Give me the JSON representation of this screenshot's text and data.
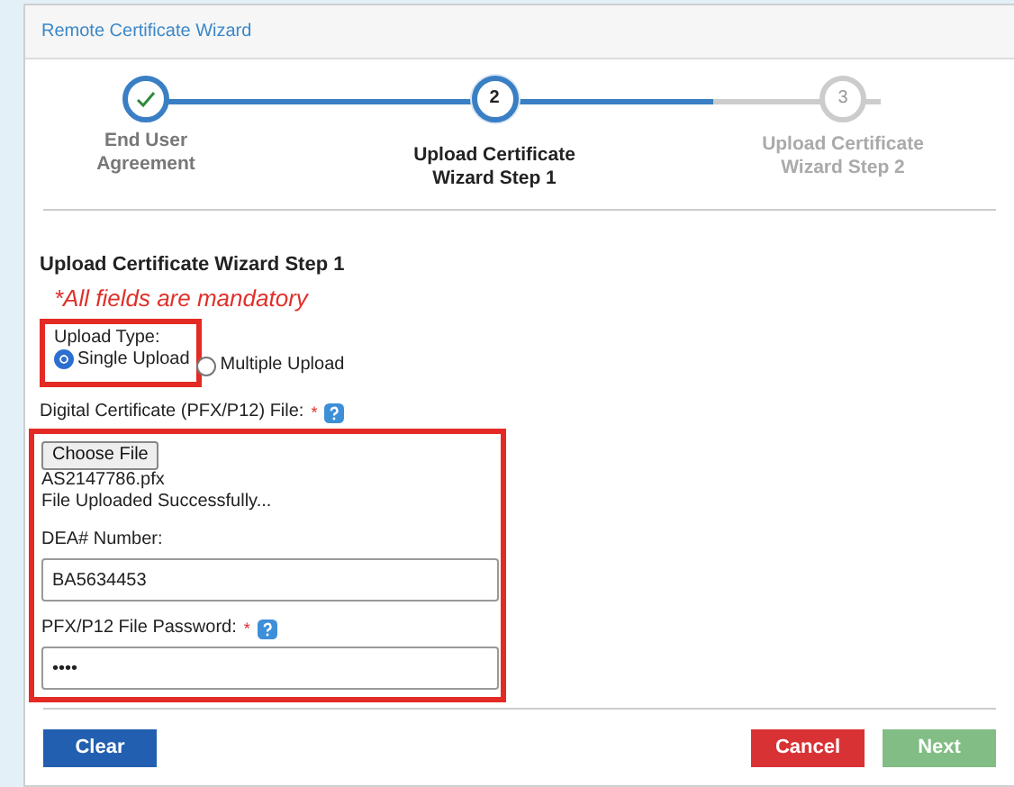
{
  "window": {
    "title": "Remote Certificate Wizard"
  },
  "steps": [
    {
      "label": "End User Agreement",
      "completed": true,
      "selected": false
    },
    {
      "marker": "2",
      "label": "Upload Certificate Wizard Step 1",
      "completed": false,
      "selected": true
    },
    {
      "marker": "3",
      "label": "Upload Certificate Wizard Step 2",
      "completed": false,
      "selected": false
    }
  ],
  "form": {
    "title": "Upload Certificate Wizard Step 1",
    "notice": "*All fields are mandatory",
    "upload_type": {
      "label": "Upload Type:",
      "options": [
        {
          "label": "Single Upload",
          "selected": true
        },
        {
          "label": "Multiple Upload",
          "selected": false
        }
      ]
    },
    "certificate": {
      "label": "Digital Certificate (PFX/P12) File:",
      "required_mark": "*",
      "button": "Choose File",
      "file_name": "AS2147786.pfx",
      "status": "File Uploaded Successfully..."
    },
    "dea": {
      "label": "DEA# Number:",
      "value": "BA5634453"
    },
    "password": {
      "label": "PFX/P12 File Password:",
      "required_mark": "*",
      "value": "••••"
    }
  },
  "buttons": [
    {
      "label": "Clear",
      "kind": "clear",
      "disabled": false
    },
    {
      "label": "Cancel",
      "kind": "cancel",
      "disabled": false
    },
    {
      "label": "Next",
      "kind": "next",
      "disabled": true
    }
  ]
}
